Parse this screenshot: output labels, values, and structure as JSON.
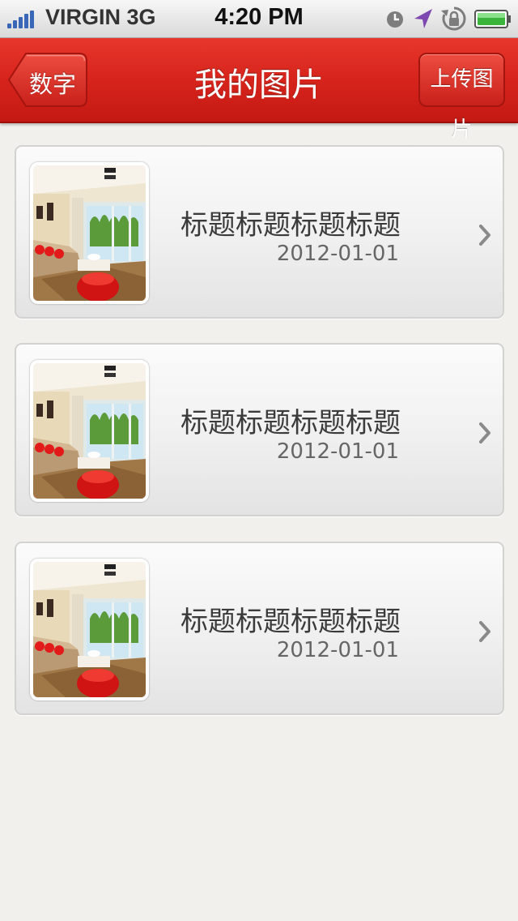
{
  "status_bar": {
    "carrier": "VIRGIN",
    "network": "3G",
    "time": "4:20 PM",
    "icons": [
      "signal-icon",
      "clock-icon",
      "location-arrow-icon",
      "rotation-lock-icon",
      "battery-icon"
    ]
  },
  "navbar": {
    "title": "我的图片",
    "back_label": "数字",
    "upload_label": "上传图片",
    "color": "#d6241c"
  },
  "list": {
    "items": [
      {
        "title": "标题标题标题标题",
        "date": "2012-01-01",
        "thumbnail": "living-room-photo"
      },
      {
        "title": "标题标题标题标题",
        "date": "2012-01-01",
        "thumbnail": "living-room-photo"
      },
      {
        "title": "标题标题标题标题",
        "date": "2012-01-01",
        "thumbnail": "living-room-photo"
      }
    ]
  },
  "colors": {
    "accent": "#d6241c",
    "background": "#f1f0ec",
    "text": "#3b3b3b"
  }
}
